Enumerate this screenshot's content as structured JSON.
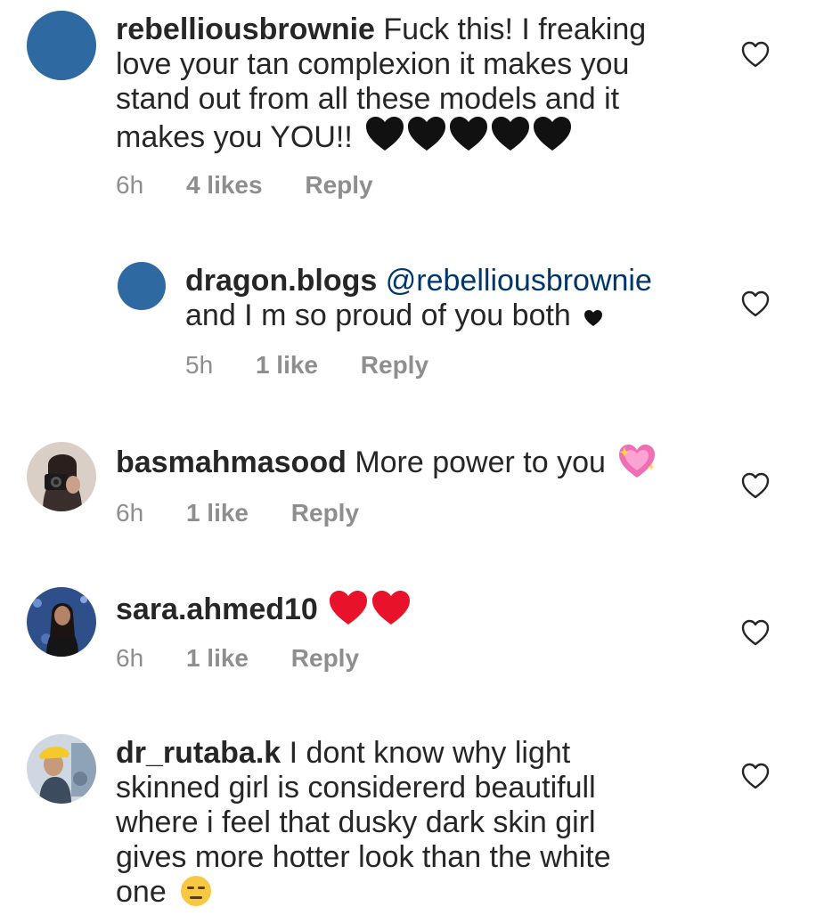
{
  "comments": [
    {
      "username": "rebelliousbrownie",
      "text_lines": [
        "Fuck this! I freaking",
        "love your tan complexion it makes you",
        "stand out from all these models and it",
        "makes you YOU!!"
      ],
      "emoji": [
        "black-heart",
        "black-heart",
        "black-heart",
        "black-heart",
        "black-heart"
      ],
      "time": "6h",
      "likes": "4 likes",
      "reply": "Reply"
    },
    {
      "username": "dragon.blogs",
      "mention": "@rebelliousbrownie",
      "text_lines": [
        "and I m so proud of you both"
      ],
      "emoji": [
        "small-black-heart"
      ],
      "time": "5h",
      "likes": "1 like",
      "reply": "Reply"
    },
    {
      "username": "basmahmasood",
      "text_lines": [
        "More power to you"
      ],
      "emoji": [
        "sparkling-heart"
      ],
      "time": "6h",
      "likes": "1 like",
      "reply": "Reply"
    },
    {
      "username": "sara.ahmed10",
      "text_lines": [],
      "emoji": [
        "red-heart",
        "red-heart"
      ],
      "time": "6h",
      "likes": "1 like",
      "reply": "Reply"
    },
    {
      "username": "dr_rutaba.k",
      "text_lines": [
        "I dont know why light",
        "skinned girl is considererd beautifull",
        "where i feel that dusky dark skin girl",
        "gives more hotter look than the white",
        "one"
      ],
      "emoji": [
        "expressionless-face"
      ]
    }
  ],
  "colors": {
    "username": "#262626",
    "mention": "#00376b",
    "meta": "#8e8e8e",
    "avatar_default": "#2e6aa1",
    "red_heart": "#e8132b"
  }
}
